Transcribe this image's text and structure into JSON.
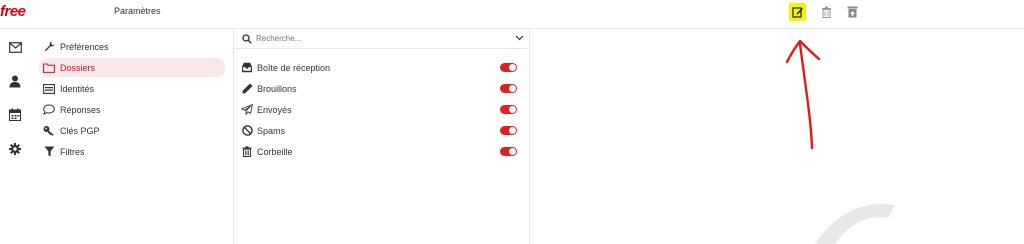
{
  "header": {
    "logo_text": "free",
    "page_title": "Paramètres",
    "toolbar": [
      {
        "icon": "compose-icon",
        "highlighted": true
      },
      {
        "icon": "trash-icon"
      },
      {
        "icon": "archive-icon"
      }
    ]
  },
  "rail": {
    "items": [
      {
        "icon": "mail-icon"
      },
      {
        "icon": "user-icon"
      },
      {
        "icon": "calendar-icon"
      },
      {
        "icon": "gear-icon"
      }
    ]
  },
  "settings_menu": {
    "items": [
      {
        "label": "Préférences",
        "icon": "wrench-icon",
        "active": false
      },
      {
        "label": "Dossiers",
        "icon": "folder-icon",
        "active": true
      },
      {
        "label": "Identités",
        "icon": "id-card-icon",
        "active": false
      },
      {
        "label": "Réponses",
        "icon": "comment-icon",
        "active": false
      },
      {
        "label": "Clés PGP",
        "icon": "key-icon",
        "active": false
      },
      {
        "label": "Filtres",
        "icon": "filter-icon",
        "active": false
      }
    ]
  },
  "folders": {
    "search_placeholder": "Recherche...",
    "items": [
      {
        "label": "Boîte de réception",
        "icon": "inbox-icon",
        "subscribed": true
      },
      {
        "label": "Brouillons",
        "icon": "pencil-icon",
        "subscribed": true
      },
      {
        "label": "Envoyés",
        "icon": "paper-plane-icon",
        "subscribed": true
      },
      {
        "label": "Spams",
        "icon": "ban-icon",
        "subscribed": true
      },
      {
        "label": "Corbeille",
        "icon": "trash-icon",
        "subscribed": true
      }
    ]
  },
  "colors": {
    "brand": "#d4001a",
    "active_bg": "#fce8ea",
    "toggle_on": "#e02020",
    "highlight": "#f2f20a",
    "annotation_arrow": "#e01a1a"
  }
}
